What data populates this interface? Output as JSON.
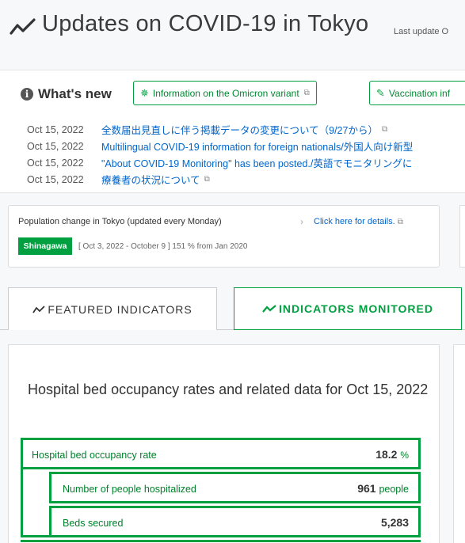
{
  "header": {
    "title": "Updates on COVID-19 in Tokyo",
    "last_update": "Last update O",
    "icon": "trend-line-icon"
  },
  "whats_new": {
    "title": "What's new",
    "buttons": [
      {
        "icon": "virus-icon",
        "label": "Information on the Omicron variant"
      },
      {
        "icon": "syringe-icon",
        "label": "Vaccination inf"
      }
    ],
    "items": [
      {
        "date": "Oct 15, 2022",
        "text": "全数届出見直しに伴う掲載データの変更について（9/27から）"
      },
      {
        "date": "Oct 15, 2022",
        "text": "Multilingual COVID-19 information for foreign nationals/外国人向け新型"
      },
      {
        "date": "Oct 15, 2022",
        "text": "\"About COVID-19 Monitoring\" has been posted./英語でモニタリングに"
      },
      {
        "date": "Oct 15, 2022",
        "text": "療養者の状況について"
      }
    ]
  },
  "population": {
    "title": "Population change in Tokyo (updated every Monday)",
    "link": "Click here for details.",
    "badge": "Shinagawa",
    "range": "[ Oct 3, 2022 - October 9 ] 151 % from Jan 2020"
  },
  "tabs": [
    {
      "label": "FEATURED INDICATORS"
    },
    {
      "label": "INDICATORS MONITORED"
    }
  ],
  "card": {
    "title": "Hospital bed occupancy rates and related data for Oct 15, 2022",
    "occupancy": {
      "label": "Hospital bed occupancy rate",
      "value": "18.2",
      "unit": "%"
    },
    "hospitalized": {
      "label": "Number of people hospitalized",
      "value": "961",
      "unit": "people"
    },
    "beds": {
      "label": "Beds secured",
      "value": "5,283"
    }
  },
  "colors": {
    "accent": "#00a040",
    "link": "#0066cc"
  }
}
